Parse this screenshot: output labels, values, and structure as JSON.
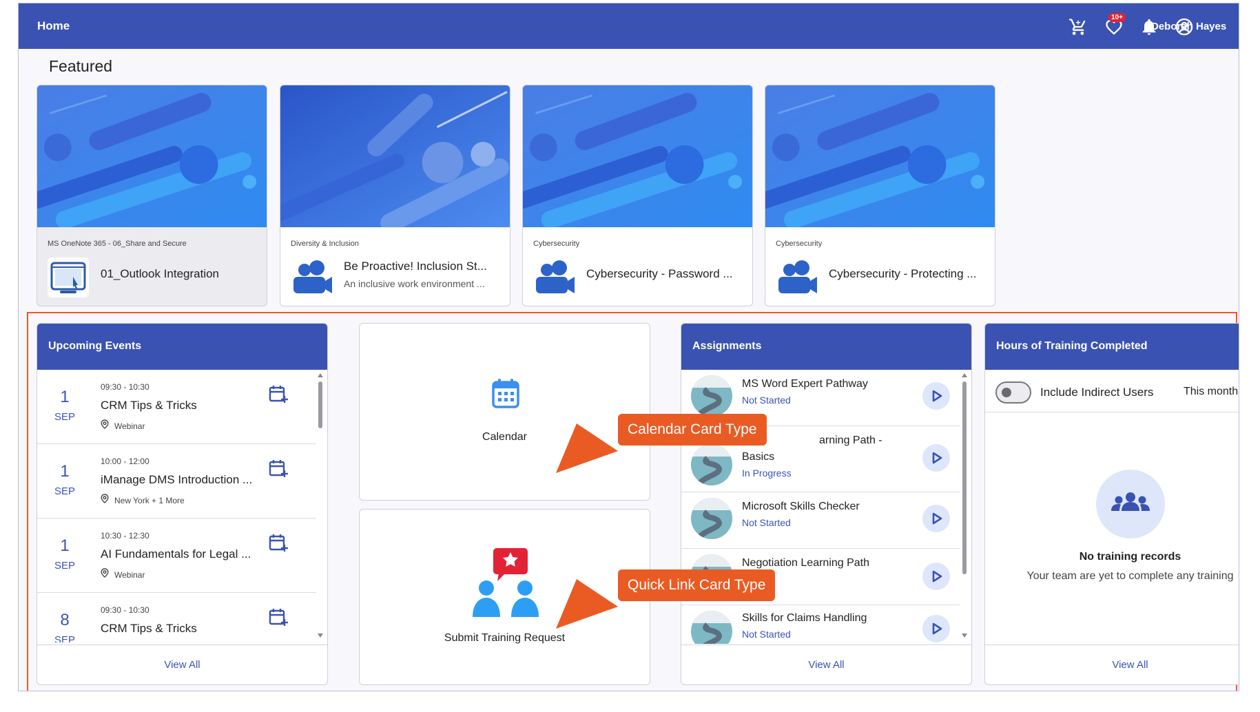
{
  "topbar": {
    "title": "Home",
    "cart_icon": "shopping-cart-icon",
    "wishlist_icon": "heart-icon",
    "notifications_icon": "bell-icon",
    "notifications_badge": "10+",
    "user_icon": "account-circle-icon",
    "user_name": "Deborah Hayes"
  },
  "featured": {
    "title": "Featured",
    "cards": [
      {
        "category": "MS OneNote 365 - 06_Share and Secure",
        "title": "01_Outlook Integration",
        "subtitle": "",
        "icon": "screen-cursor-icon"
      },
      {
        "category": "Diversity & Inclusion",
        "title": "Be Proactive! Inclusion St...",
        "subtitle": "An inclusive work environment ...",
        "icon": "video-meeting-icon"
      },
      {
        "category": "Cybersecurity",
        "title": "Cybersecurity - Password ...",
        "subtitle": "",
        "icon": "video-meeting-icon"
      },
      {
        "category": "Cybersecurity",
        "title": "Cybersecurity - Protecting ...",
        "subtitle": "",
        "icon": "video-meeting-icon"
      }
    ]
  },
  "events": {
    "title": "Upcoming Events",
    "view_all": "View All",
    "items": [
      {
        "day": "1",
        "month": "SEP",
        "time": "09:30 - 10:30",
        "title": "CRM Tips & Tricks",
        "location": "Webinar"
      },
      {
        "day": "1",
        "month": "SEP",
        "time": "10:00 - 12:00",
        "title": "iManage DMS Introduction ...",
        "location": "New York + 1 More"
      },
      {
        "day": "1",
        "month": "SEP",
        "time": "10:30 - 12:30",
        "title": "AI Fundamentals for Legal ...",
        "location": "Webinar"
      },
      {
        "day": "8",
        "month": "SEP",
        "time": "09:30 - 10:30",
        "title": "CRM Tips & Tricks",
        "location": ""
      }
    ]
  },
  "calendar_card": {
    "label": "Calendar",
    "icon": "calendar-icon"
  },
  "request_card": {
    "label": "Submit Training Request",
    "icon": "team-star-icon"
  },
  "assignments": {
    "title": "Assignments",
    "view_all": "View All",
    "items": [
      {
        "title": "MS Word Expert Pathway",
        "status": "Not Started"
      },
      {
        "title": "arning Path -",
        "title_line2": "Basics",
        "status": "In Progress"
      },
      {
        "title": "Microsoft Skills Checker",
        "status": "Not Started"
      },
      {
        "title": "Negotiation Learning Path",
        "status": ""
      },
      {
        "title": "Skills for Claims Handling",
        "status": "Not Started"
      }
    ]
  },
  "hours": {
    "title": "Hours of Training Completed",
    "toggle_label": "Include Indirect Users",
    "period": "This month",
    "empty_title": "No training records",
    "empty_text": "Your team are yet to complete any training",
    "view_all": "View All"
  },
  "callouts": {
    "calendar": "Calendar Card Type",
    "quick_link": "Quick Link Card Type"
  },
  "colors": {
    "brand": "#3a53b2",
    "callout": "#ea5b23",
    "badge": "#e12335"
  }
}
